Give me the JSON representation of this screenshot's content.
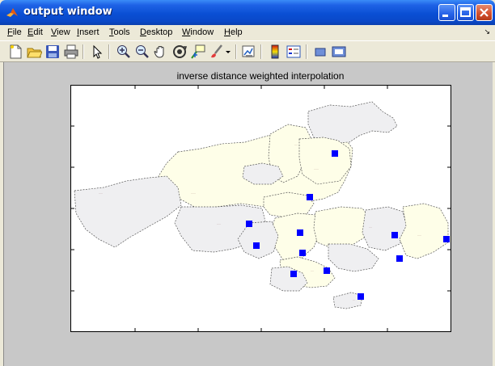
{
  "window": {
    "title": "output window",
    "icon": "matlab-icon"
  },
  "menu": [
    {
      "label": "File",
      "underline": "F",
      "rest": "ile"
    },
    {
      "label": "Edit",
      "underline": "E",
      "rest": "dit"
    },
    {
      "label": "View",
      "underline": "V",
      "rest": "iew"
    },
    {
      "label": "Insert",
      "underline": "I",
      "rest": "nsert"
    },
    {
      "label": "Tools",
      "underline": "T",
      "rest": "ools"
    },
    {
      "label": "Desktop",
      "underline": "D",
      "rest": "esktop"
    },
    {
      "label": "Window",
      "underline": "W",
      "rest": "indow"
    },
    {
      "label": "Help",
      "underline": "H",
      "rest": "elp"
    }
  ],
  "toolbar": [
    "new-figure-icon",
    "open-file-icon",
    "save-icon",
    "print-icon",
    "select-arrow-icon",
    "zoom-in-icon",
    "zoom-out-icon",
    "pan-hand-icon",
    "rotate-3d-icon",
    "data-cursor-icon",
    "brush-icon",
    "link-plot-icon",
    "colorbar-icon",
    "legend-icon",
    "hide-plot-tools-icon",
    "show-plot-tools-icon"
  ],
  "plot": {
    "title": "inverse distance weighted interpolation"
  },
  "colors": {
    "region_fill_light": "#fefee8",
    "region_fill_gray": "#efeff1",
    "marker": "#0000ff",
    "titlebar": "#0a4fd4"
  }
}
